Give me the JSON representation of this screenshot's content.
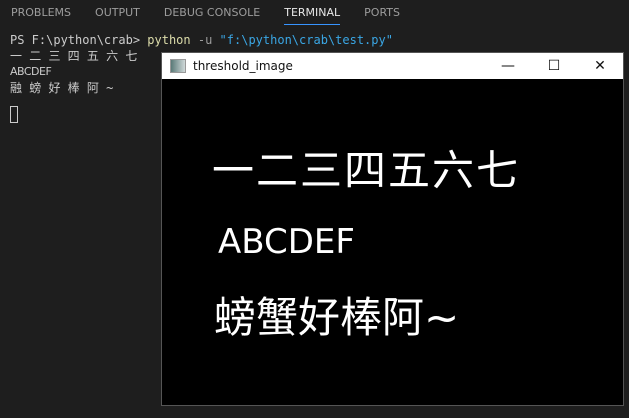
{
  "tabs": [
    "PROBLEMS",
    "OUTPUT",
    "DEBUG CONSOLE",
    "TERMINAL",
    "PORTS"
  ],
  "terminal": {
    "prompt": "PS F:\\python\\crab> ",
    "cmd": "python",
    "flag": " -u ",
    "arg": "\"f:\\python\\crab\\test.py\"",
    "lines": [
      "一 二 三 四 五 六 七",
      "ABCDEF",
      "融 螃 好 棒 阿 ~"
    ]
  },
  "window": {
    "title": "threshold_image",
    "minimize": "—",
    "maximize": "☐",
    "close": "✕",
    "image_lines": [
      "一二三四五六七",
      "ABCDEF",
      "螃蟹好棒阿~"
    ]
  }
}
